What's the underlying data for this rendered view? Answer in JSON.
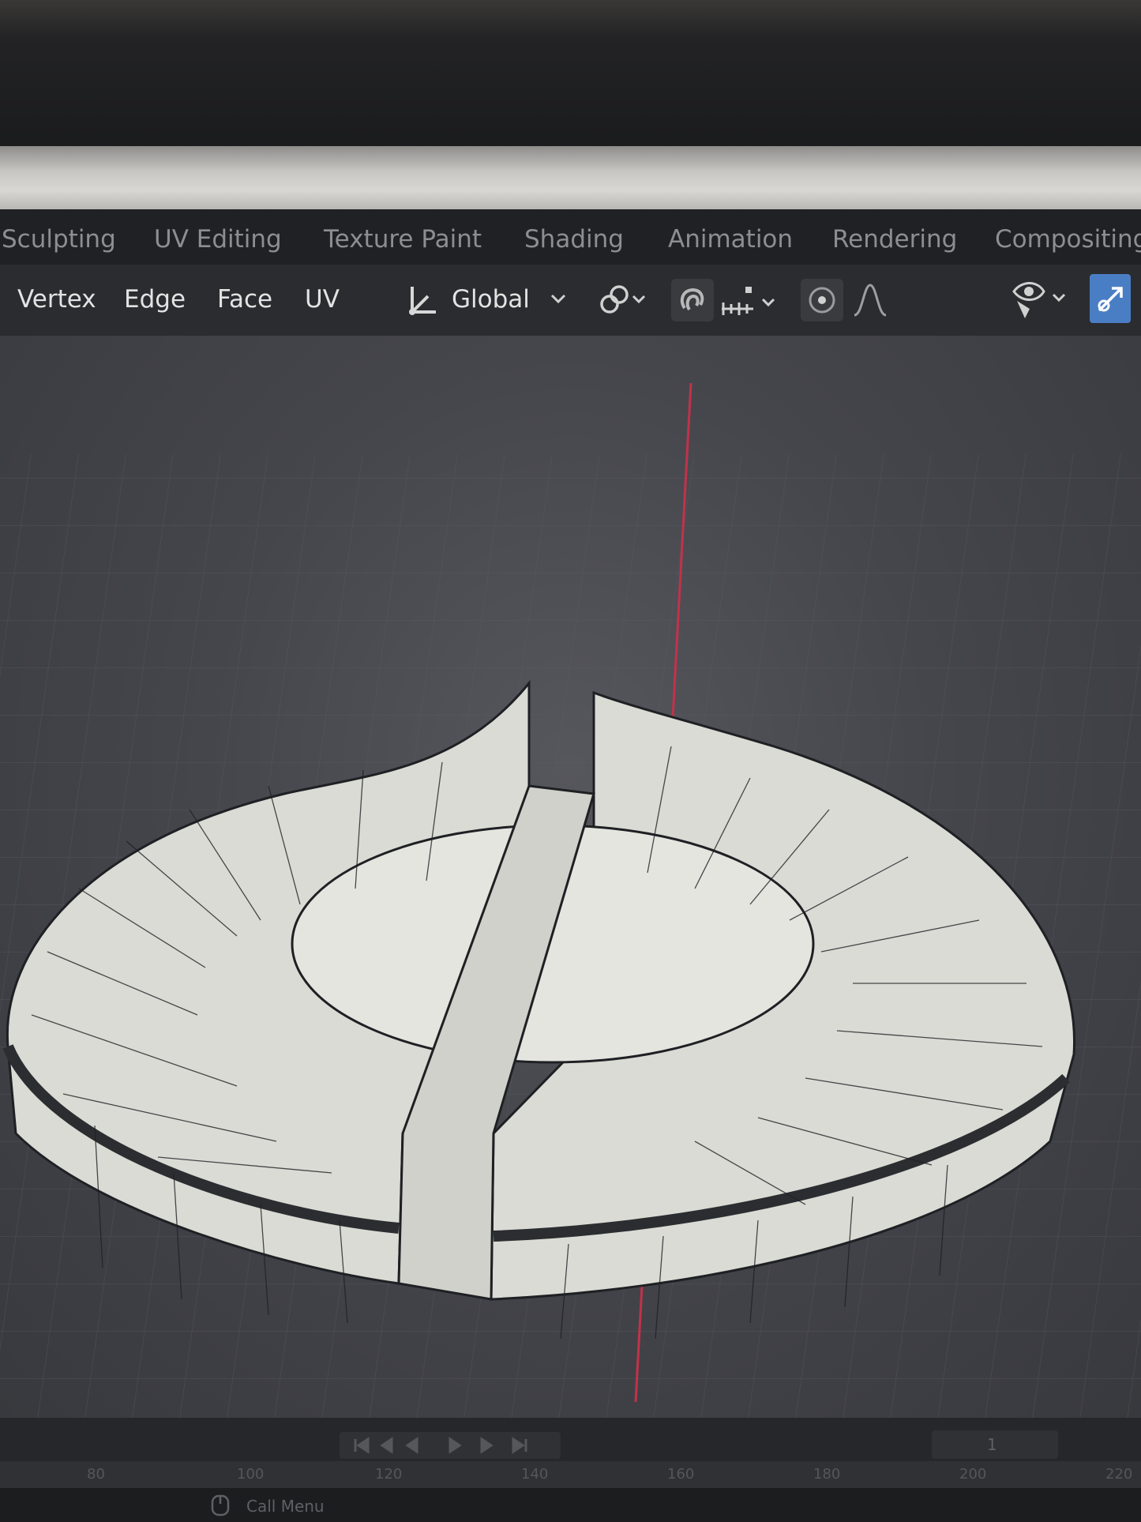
{
  "workspace_tabs": [
    "Sculpting",
    "UV Editing",
    "Texture Paint",
    "Shading",
    "Animation",
    "Rendering",
    "Compositing"
  ],
  "select_modes": {
    "vertex": "Vertex",
    "edge": "Edge",
    "face": "Face",
    "uv": "UV"
  },
  "transform_orientation": {
    "value": "Global",
    "icon": "transform-orientation-icon"
  },
  "header_icons": [
    "pivot-point-icon",
    "snap-magnet-icon",
    "snap-increment-icon",
    "proportional-editing-icon",
    "falloff-curve-icon",
    "visibility-eye-icon",
    "gizmo-toggle-icon"
  ],
  "timeline": {
    "frame_ticks": [
      "80",
      "100",
      "120",
      "140",
      "160",
      "180",
      "200",
      "220"
    ],
    "current_frame": "1"
  },
  "statusbar": {
    "call_menu": "Call Menu"
  },
  "colors": {
    "x_axis": "#c2324a",
    "mesh_face": "#d9dbd4",
    "wire": "#1f2024",
    "active_gizmo": "#4a7ec4"
  }
}
